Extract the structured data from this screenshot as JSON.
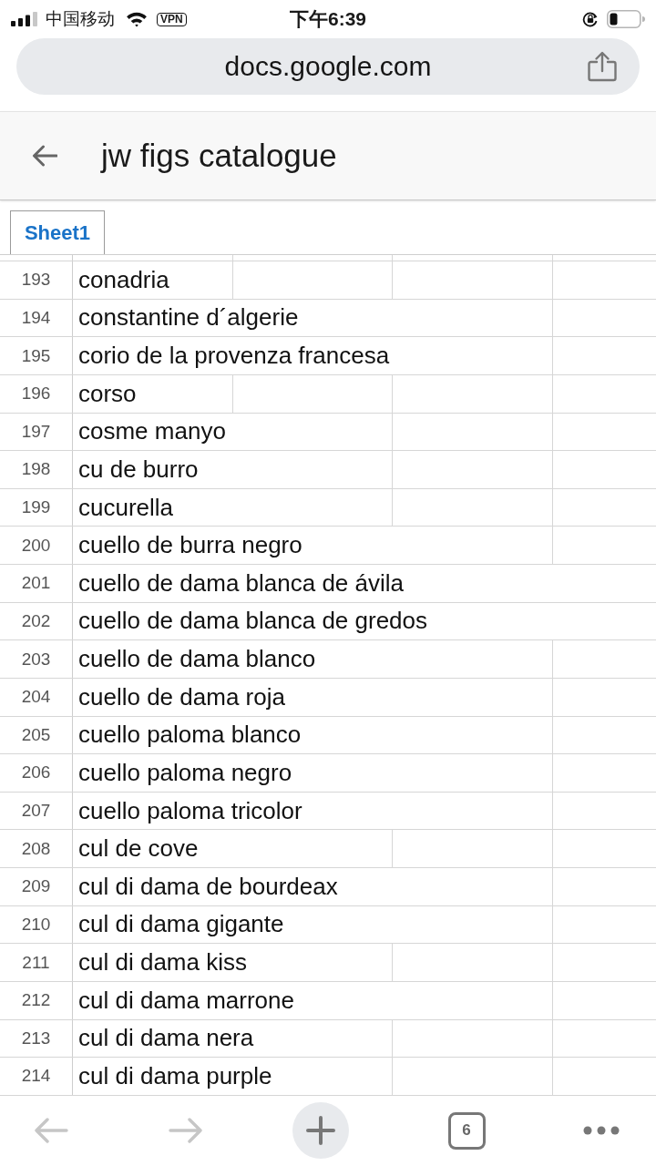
{
  "status_bar": {
    "carrier": "中国移动",
    "vpn": "VPN",
    "time": "下午6:39"
  },
  "browser": {
    "url": "docs.google.com"
  },
  "document": {
    "title": "jw figs catalogue"
  },
  "sheet_tabs": [
    {
      "label": "Sheet1",
      "selected": true
    }
  ],
  "grid": {
    "rows": [
      {
        "number": "193",
        "text": "conadria"
      },
      {
        "number": "194",
        "text": "constantine d´algerie"
      },
      {
        "number": "195",
        "text": "corio de la provenza francesa"
      },
      {
        "number": "196",
        "text": "corso"
      },
      {
        "number": "197",
        "text": "cosme manyo"
      },
      {
        "number": "198",
        "text": "cu de burro"
      },
      {
        "number": "199",
        "text": "cucurella"
      },
      {
        "number": "200",
        "text": "cuello de burra negro"
      },
      {
        "number": "201",
        "text": "cuello de dama blanca de ávila"
      },
      {
        "number": "202",
        "text": "cuello de dama blanca de gredos"
      },
      {
        "number": "203",
        "text": "cuello de dama blanco"
      },
      {
        "number": "204",
        "text": "cuello de dama roja"
      },
      {
        "number": "205",
        "text": "cuello paloma blanco"
      },
      {
        "number": "206",
        "text": "cuello paloma negro"
      },
      {
        "number": "207",
        "text": "cuello paloma tricolor"
      },
      {
        "number": "208",
        "text": "cul de cove"
      },
      {
        "number": "209",
        "text": "cul di dama de bourdeax"
      },
      {
        "number": "210",
        "text": "cul di dama gigante"
      },
      {
        "number": "211",
        "text": "cul di dama kiss"
      },
      {
        "number": "212",
        "text": "cul di dama marrone"
      },
      {
        "number": "213",
        "text": "cul di dama nera"
      },
      {
        "number": "214",
        "text": "cul di dama purple"
      }
    ]
  },
  "toolbar": {
    "buttons": [
      {
        "kind": "back",
        "disabled": true
      },
      {
        "kind": "forward",
        "disabled": true
      },
      {
        "kind": "new_tab",
        "disabled": false
      },
      {
        "kind": "tabs",
        "disabled": false,
        "count": "6"
      },
      {
        "kind": "menu",
        "disabled": false
      }
    ]
  }
}
